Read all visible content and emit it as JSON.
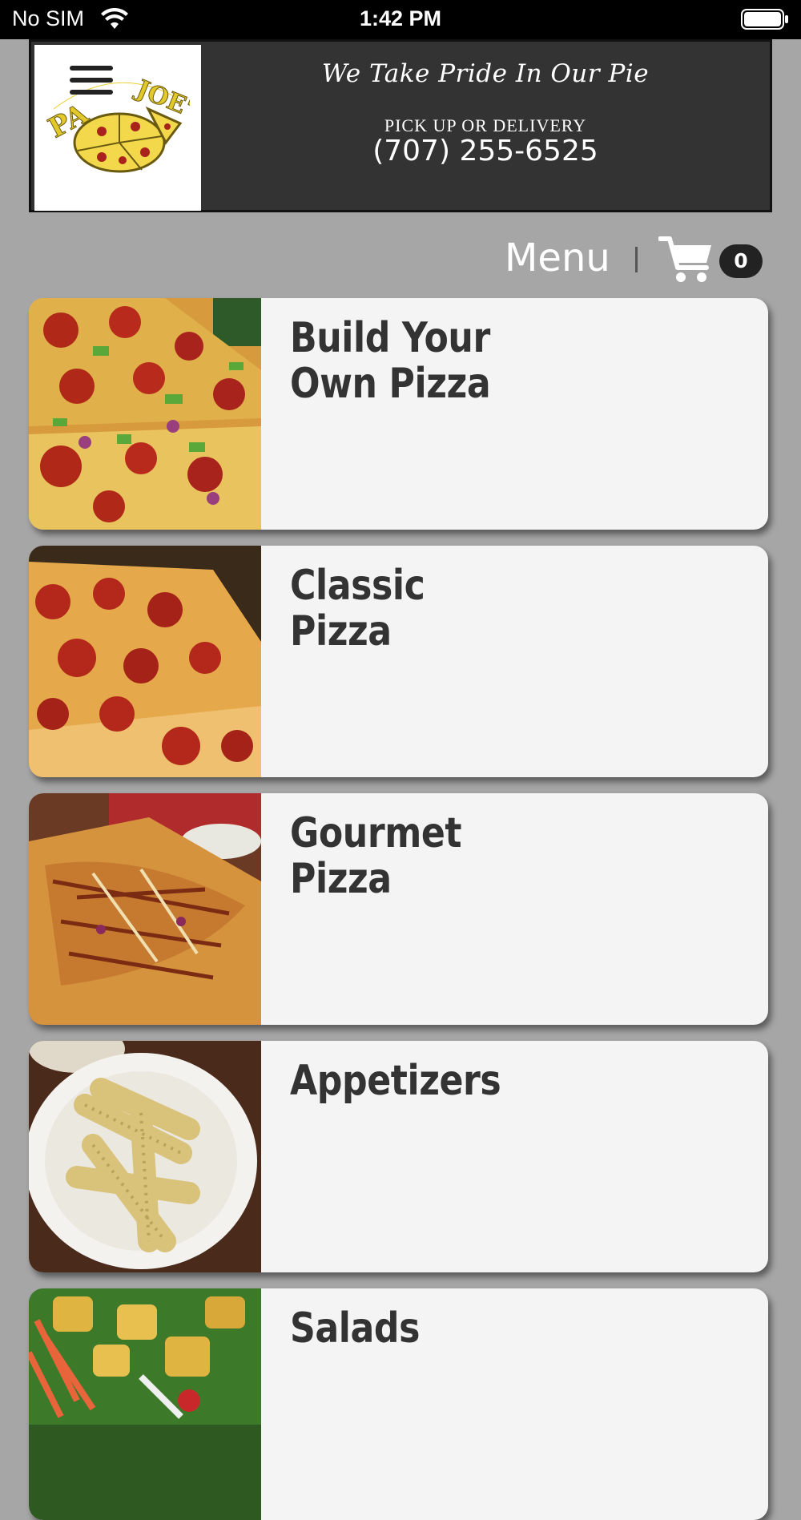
{
  "status_bar": {
    "carrier": "No SIM",
    "time": "1:42 PM"
  },
  "header": {
    "logo_text": "PAPA JOE'S",
    "tagline": "We Take Pride In Our Pie",
    "pickup_label": "PICK UP OR DELIVERY",
    "phone": "(707) 255-6525"
  },
  "nav": {
    "menu_label": "Menu",
    "cart_count": "0"
  },
  "categories": [
    {
      "title": "Build Your\nOwn Pizza",
      "image": "pepperoni-veggie-pizza"
    },
    {
      "title": "Classic Pizza",
      "image": "pepperoni-pizza"
    },
    {
      "title": "Gourmet\nPizza",
      "image": "bbq-pizza"
    },
    {
      "title": "Appetizers",
      "image": "garlic-knots"
    },
    {
      "title": "Salads",
      "image": "salad"
    }
  ],
  "colors": {
    "background": "#a6a6a6",
    "banner": "#333333",
    "card": "#f4f4f4",
    "title_text": "#333333"
  }
}
